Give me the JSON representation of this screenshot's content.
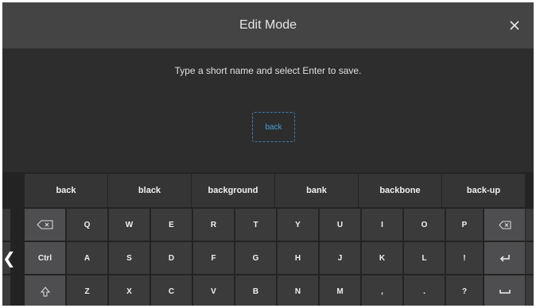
{
  "header": {
    "title": "Edit Mode",
    "close_icon": "close-icon"
  },
  "prompt": {
    "instruction": "Type a short name and select Enter to save.",
    "input_value": "back"
  },
  "keyboard": {
    "suggestions": [
      "back",
      "black",
      "background",
      "bank",
      "backbone",
      "back-up"
    ],
    "row1": [
      "",
      "Q",
      "W",
      "E",
      "R",
      "T",
      "Y",
      "U",
      "I",
      "O",
      "P",
      ""
    ],
    "row2": [
      "Ctrl",
      "A",
      "S",
      "D",
      "F",
      "G",
      "H",
      "J",
      "K",
      "L",
      "!",
      ""
    ],
    "row3": [
      "",
      "Z",
      "X",
      "C",
      "V",
      "B",
      "N",
      "M",
      ",",
      ".",
      "?",
      ""
    ],
    "icons": {
      "row1_left": "alt-backspace-icon",
      "row1_right": "backspace-icon",
      "row2_right": "enter-icon",
      "row3_left": "shift-icon",
      "row3_right": "space-icon",
      "side_left": "chevron-left-icon"
    },
    "colors": {
      "background": "#2d2d2e",
      "title_bar": "#444445",
      "key": "#3b3b3c",
      "modifier_key": "#4e4e50",
      "accent": "#4a9fd6"
    }
  }
}
